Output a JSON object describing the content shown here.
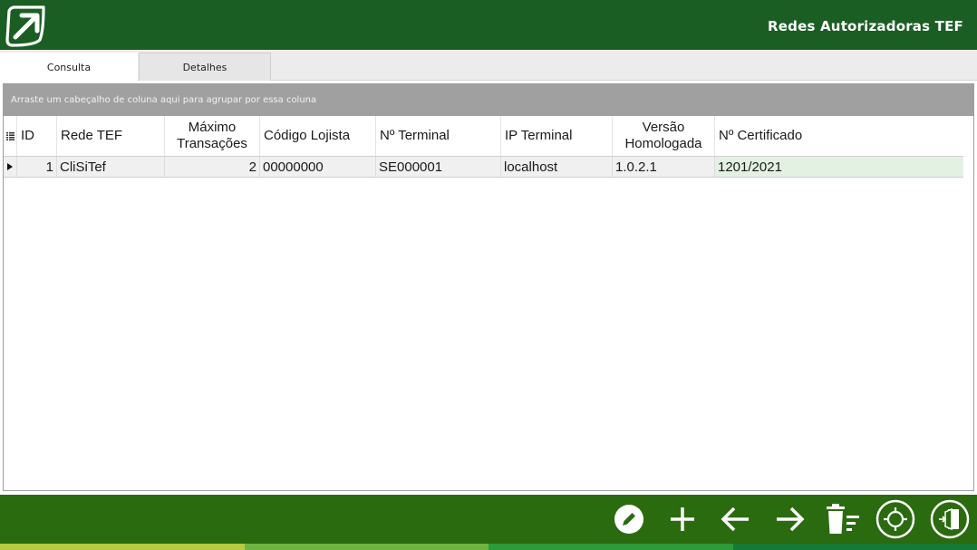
{
  "header": {
    "title": "Redes Autorizadoras TEF",
    "logo_icon": "arrow-up-right-logo-icon"
  },
  "tabs": [
    {
      "label": "Consulta",
      "active": true
    },
    {
      "label": "Detalhes",
      "active": false
    }
  ],
  "grid": {
    "group_hint": "Arraste um cabeçalho de coluna aqui para agrupar por essa coluna",
    "columns": [
      {
        "line1": "ID",
        "line2": ""
      },
      {
        "line1": "Rede TEF",
        "line2": ""
      },
      {
        "line1": "Máximo",
        "line2": "Transações"
      },
      {
        "line1": "Código Lojista",
        "line2": ""
      },
      {
        "line1": "Nº Terminal",
        "line2": ""
      },
      {
        "line1": "IP Terminal",
        "line2": ""
      },
      {
        "line1": "Versão",
        "line2": "Homologada"
      },
      {
        "line1": "Nº Certificado",
        "line2": ""
      }
    ],
    "rows": [
      [
        "1",
        "CliSiTef",
        "2",
        "00000000",
        "SE000001",
        "localhost",
        "1.0.2.1",
        "1201/2021"
      ]
    ]
  },
  "footer": {
    "buttons": [
      {
        "name": "edit-button",
        "icon": "pencil-icon"
      },
      {
        "name": "add-button",
        "icon": "plus-icon"
      },
      {
        "name": "previous-button",
        "icon": "arrow-left-icon"
      },
      {
        "name": "next-button",
        "icon": "arrow-right-icon"
      },
      {
        "name": "delete-button",
        "icon": "trash-list-icon"
      },
      {
        "name": "locate-button",
        "icon": "crosshair-icon"
      },
      {
        "name": "exit-button",
        "icon": "exit-door-icon"
      }
    ]
  },
  "colors": {
    "header_bg": "#1b5e24",
    "footer_bg": "#2b6b10",
    "group_bar_bg": "#a0a0a0",
    "selected_cell_bg": "#e3f1e3",
    "stripe_1": "#b7c93c",
    "stripe_2": "#6fb341",
    "stripe_3": "#2d9b3a",
    "stripe_4": "#157a38"
  }
}
